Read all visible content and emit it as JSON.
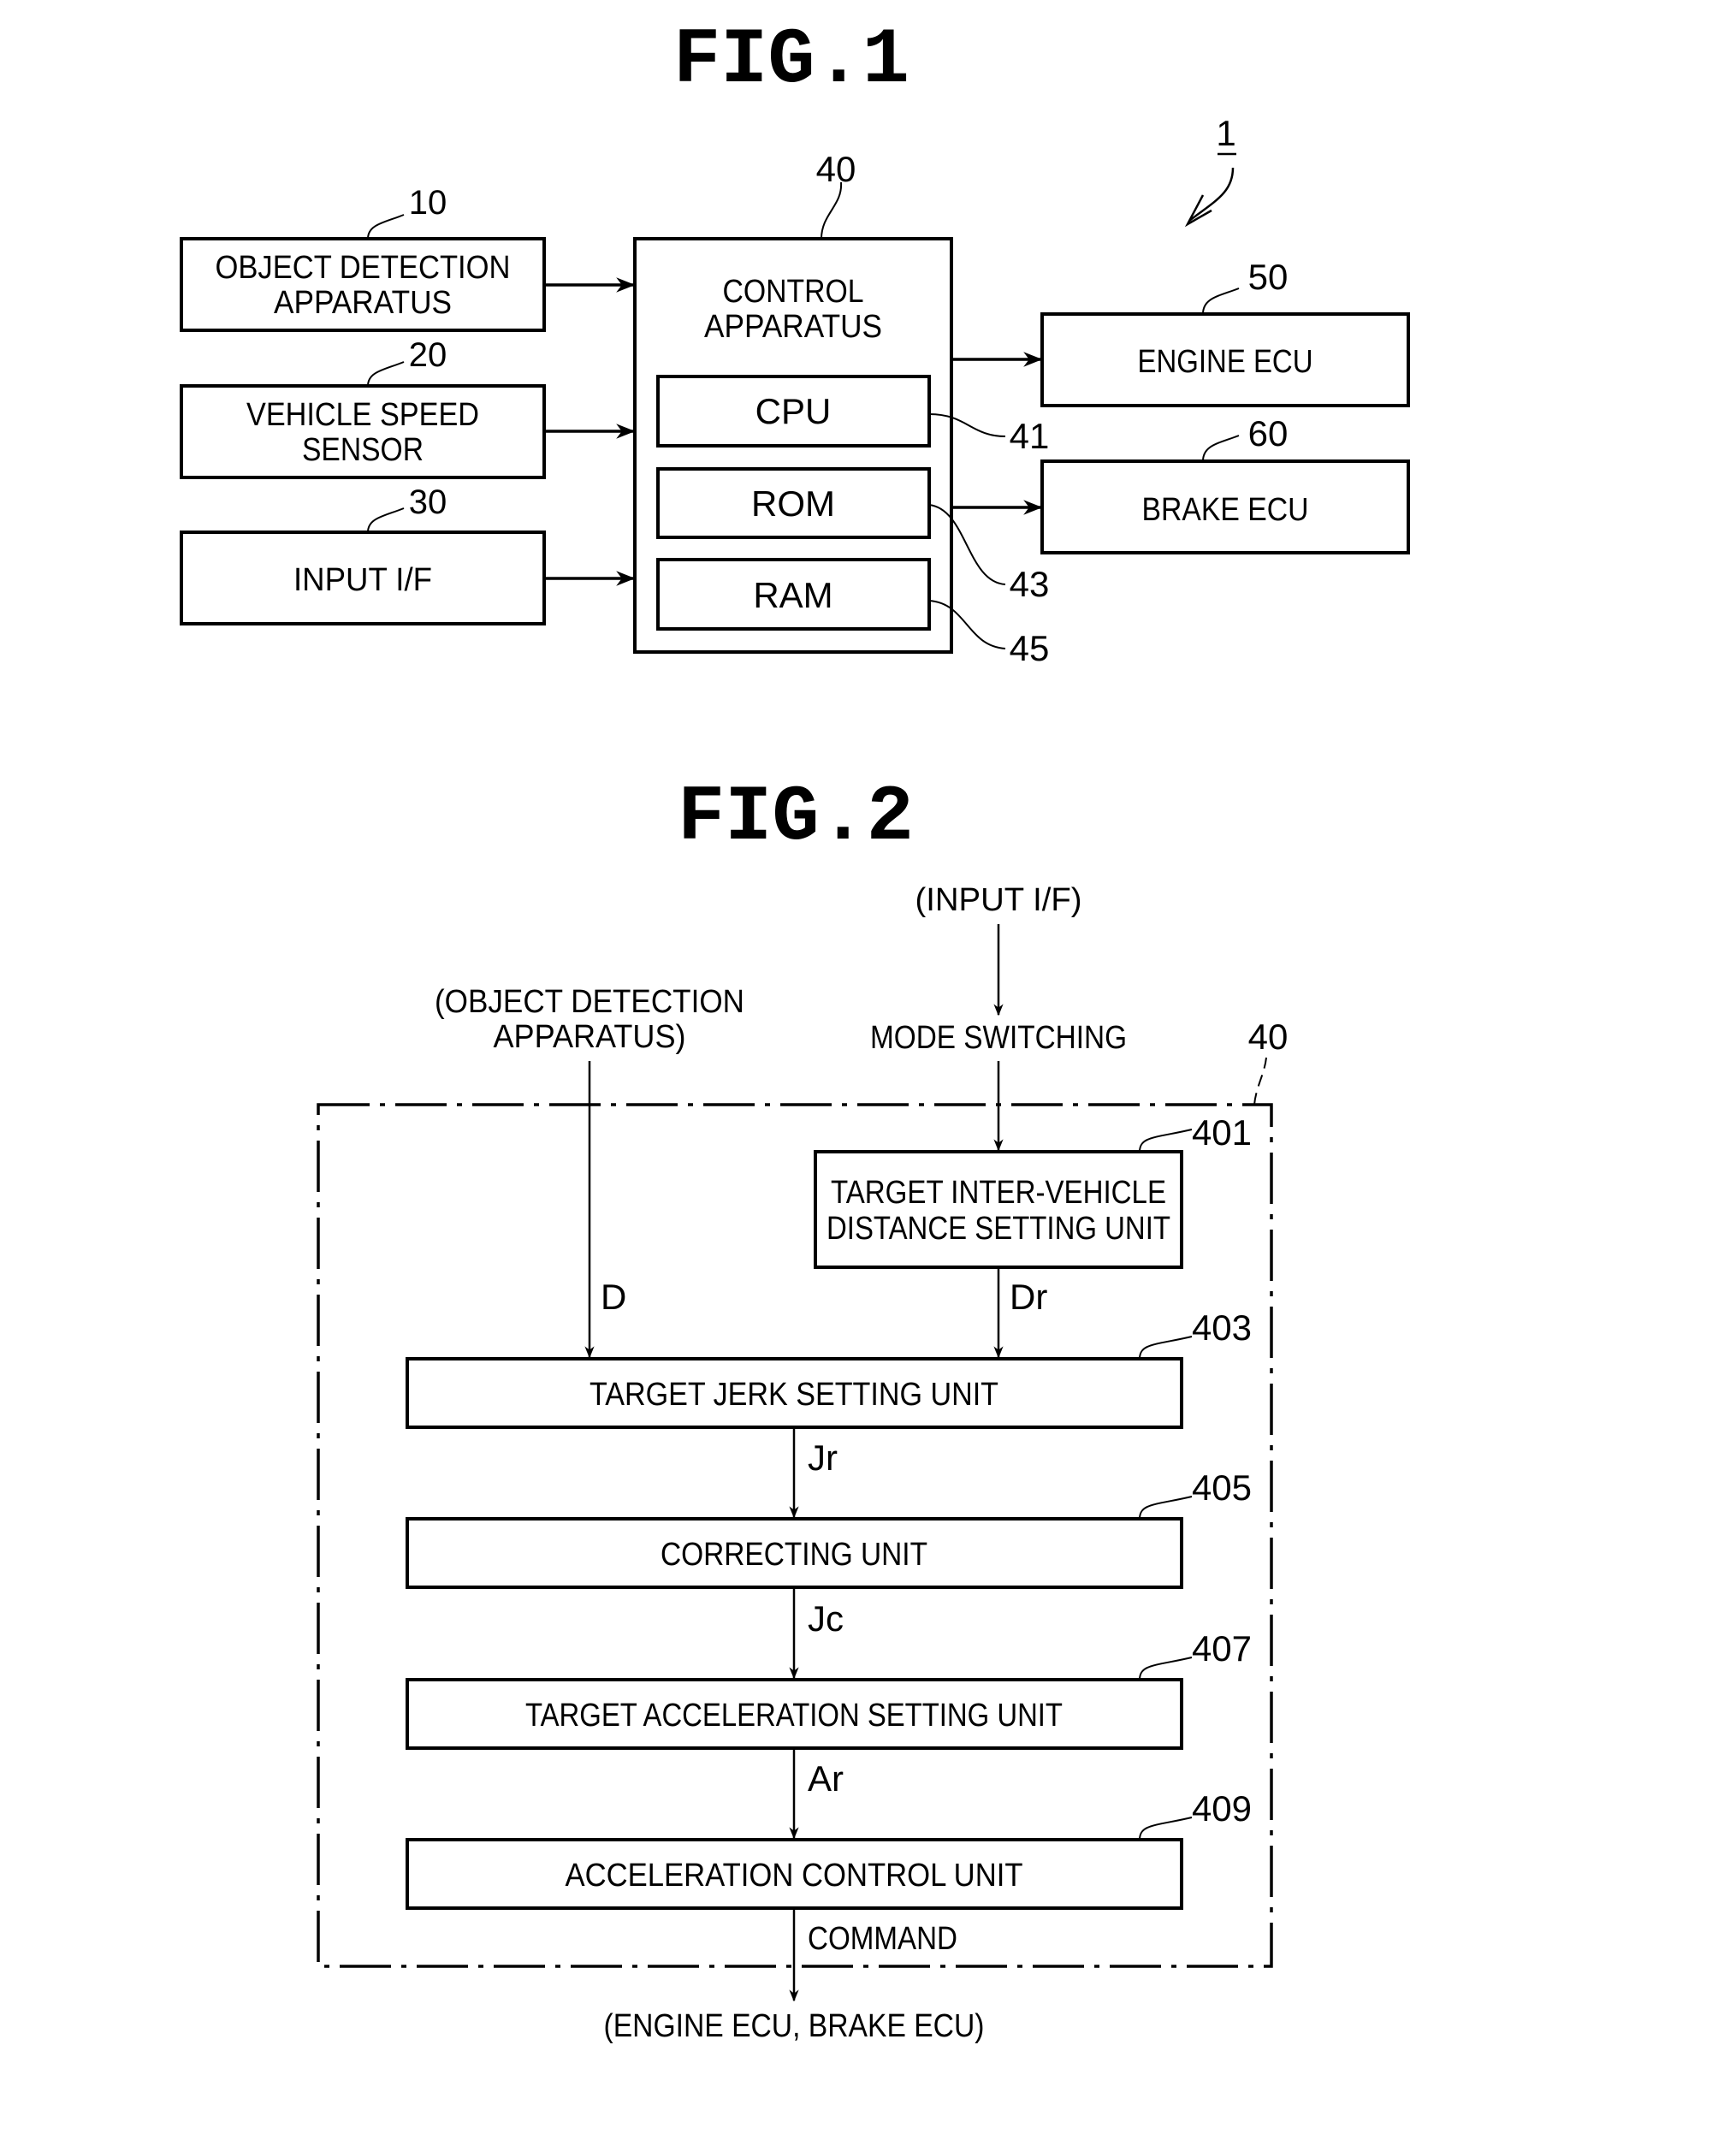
{
  "fig1": {
    "title": "FIG.1",
    "system_ref": "1",
    "blocks": {
      "object_detection": {
        "ref": "10",
        "lines": [
          "OBJECT DETECTION",
          "APPARATUS"
        ]
      },
      "vehicle_speed": {
        "ref": "20",
        "lines": [
          "VEHICLE SPEED",
          "SENSOR"
        ]
      },
      "input_if": {
        "ref": "30",
        "lines": [
          "INPUT I/F"
        ]
      },
      "control": {
        "ref": "40",
        "lines": [
          "CONTROL",
          "APPARATUS"
        ]
      },
      "cpu": {
        "ref": "41",
        "label": "CPU"
      },
      "rom": {
        "ref": "43",
        "label": "ROM"
      },
      "ram": {
        "ref": "45",
        "label": "RAM"
      },
      "engine_ecu": {
        "ref": "50",
        "label": "ENGINE ECU"
      },
      "brake_ecu": {
        "ref": "60",
        "label": "BRAKE ECU"
      }
    }
  },
  "fig2": {
    "title": "FIG.2",
    "container_ref": "40",
    "inputs": {
      "input_if": "(INPUT I/F)",
      "mode_switching": "MODE SWITCHING",
      "object_detection": [
        "(OBJECT DETECTION",
        "APPARATUS)"
      ]
    },
    "units": {
      "u401": {
        "ref": "401",
        "lines": [
          "TARGET INTER-VEHICLE",
          "DISTANCE SETTING UNIT"
        ]
      },
      "u403": {
        "ref": "403",
        "label": "TARGET JERK SETTING UNIT"
      },
      "u405": {
        "ref": "405",
        "label": "CORRECTING UNIT"
      },
      "u407": {
        "ref": "407",
        "label": "TARGET ACCELERATION SETTING UNIT"
      },
      "u409": {
        "ref": "409",
        "label": "ACCELERATION CONTROL UNIT"
      }
    },
    "signals": {
      "d": "D",
      "dr": "Dr",
      "jr": "Jr",
      "jc": "Jc",
      "ar": "Ar",
      "command": "COMMAND"
    },
    "output": "(ENGINE ECU, BRAKE ECU)"
  }
}
